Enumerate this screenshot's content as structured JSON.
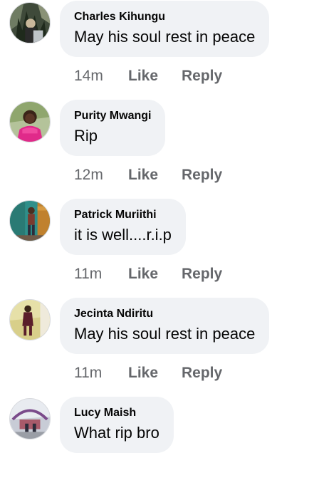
{
  "comments": [
    {
      "author": "Charles Kihungu",
      "text": "May his soul rest in peace",
      "time": "14m",
      "like_label": "Like",
      "reply_label": "Reply",
      "avatar_icon": "profile-photo"
    },
    {
      "author": "Purity Mwangi",
      "text": "Rip",
      "time": "12m",
      "like_label": "Like",
      "reply_label": "Reply",
      "avatar_icon": "profile-photo"
    },
    {
      "author": "Patrick Muriithi",
      "text": "it is well....r.i.p",
      "time": "11m",
      "like_label": "Like",
      "reply_label": "Reply",
      "avatar_icon": "profile-photo"
    },
    {
      "author": "Jecinta Ndiritu",
      "text": "May his soul rest in peace",
      "time": "11m",
      "like_label": "Like",
      "reply_label": "Reply",
      "avatar_icon": "profile-photo"
    },
    {
      "author": "Lucy Maish",
      "text": "What rip bro",
      "avatar_icon": "profile-photo"
    }
  ],
  "colors": {
    "bubble_bg": "#f0f2f5",
    "name_text": "#050505",
    "meta_text": "#65676b"
  }
}
